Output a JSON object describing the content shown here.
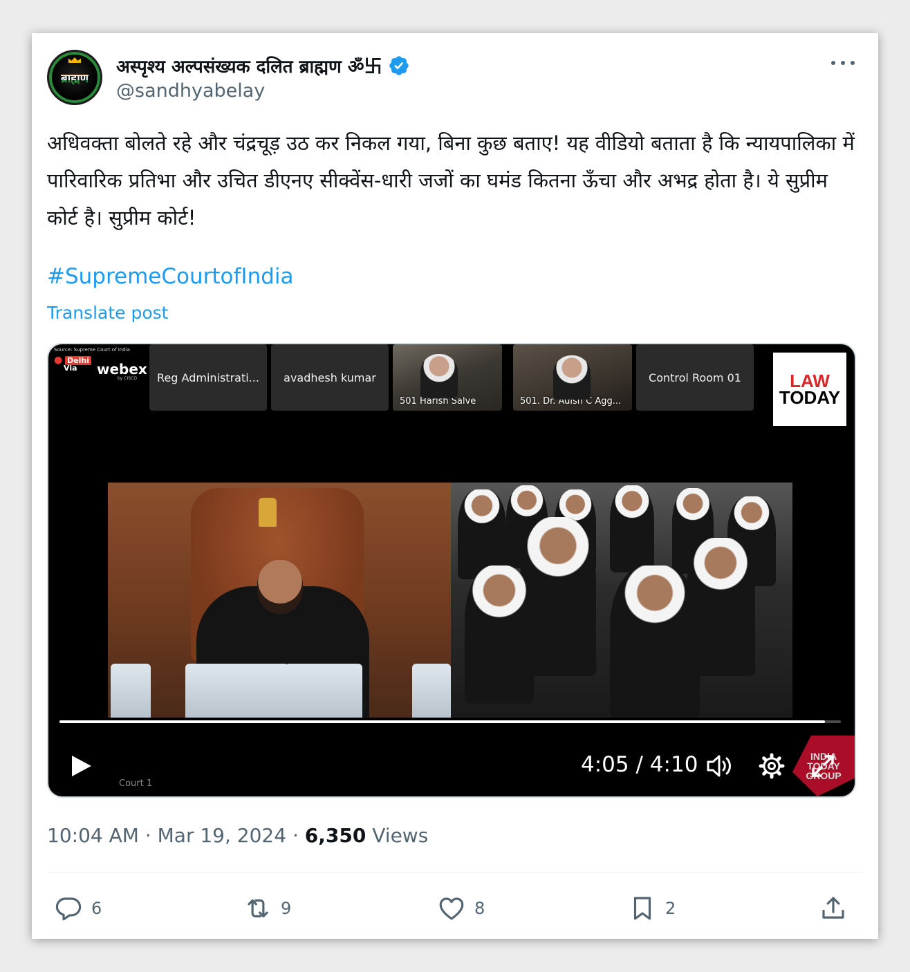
{
  "author": {
    "display_name": "अस्पृश्य अल्पसंख्यक दलित ब्राह्मण ॐ卐",
    "handle": "@sandhyabelay",
    "avatar_text": "ब्राह्मण"
  },
  "tweet": {
    "text": "अधिवक्ता बोलते रहे और चंद्रचूड़ उठ कर निकल गया, बिना कुछ बताए! यह वीडियो बताता है कि न्यायपालिका में पारिवारिक प्रतिभा और उचित डीएनए सीक्वेंस-धारी जजों का घमंड कितना ऊँचा और अभद्र होता है। ये सुप्रीम कोर्ट है। सुप्रीम कोर्ट!",
    "hashtag": "#SupremeCourtofIndia",
    "translate_label": "Translate post"
  },
  "video": {
    "source_caption": "Source: Supreme Court of India",
    "delhi_logo": "Delhi",
    "delhi_logo_sub": "Via",
    "webex_logo": "webex",
    "webex_sub": "by CISCO",
    "tiles": [
      "Reg Administrati...",
      "avadhesh kumar",
      "501 Harish Salve",
      "501. Dr. Adish C Agg...",
      "Control Room 01"
    ],
    "law_today": {
      "line1": "LAW",
      "line2": "TODAY"
    },
    "court_label": "Court 1",
    "time_current": "4:05",
    "time_separator": "/",
    "time_total": "4:10",
    "progress": 0.98,
    "india_today": {
      "line1": "INDIA",
      "line2": "TODAY",
      "line3": "GROUP"
    }
  },
  "meta": {
    "time": "10:04 AM",
    "separator": "·",
    "date": "Mar 19, 2024",
    "views_count": "6,350",
    "views_label": "Views"
  },
  "actions": {
    "replies": "6",
    "reposts": "9",
    "likes": "8",
    "bookmarks": "2"
  },
  "colors": {
    "link": "#1d9bf0",
    "secondary_text": "#536471",
    "verified": "#1d9bf0"
  },
  "icons": [
    "verified-badge-icon",
    "more-icon",
    "play-icon",
    "volume-icon",
    "settings-icon",
    "expand-icon",
    "reply-icon",
    "repost-icon",
    "like-icon",
    "bookmark-icon",
    "share-icon"
  ]
}
